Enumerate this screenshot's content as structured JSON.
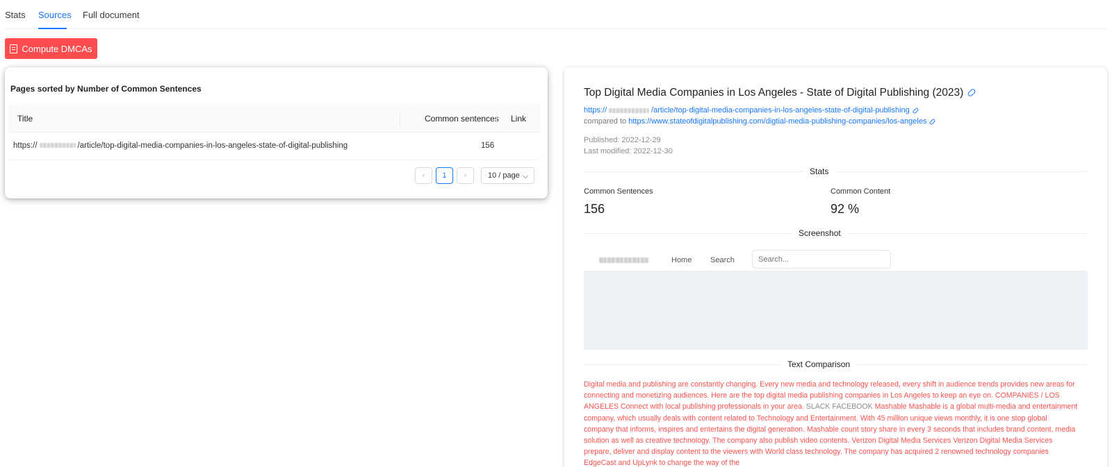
{
  "tabs": [
    {
      "label": "Stats",
      "active": false
    },
    {
      "label": "Sources",
      "active": true
    },
    {
      "label": "Full document",
      "active": false
    }
  ],
  "compute_button": {
    "label": "Compute DMCAs",
    "icon": "report-icon",
    "color": "#ff4d4f"
  },
  "sources_table": {
    "title": "Pages sorted by Number of Common Sentences",
    "columns": [
      "Title",
      "Common sentences",
      "Link"
    ],
    "rows": [
      {
        "title_prefix": "https://",
        "title_suffix": "/article/top-digital-media-companies-in-los-angeles-state-of-digital-publishing",
        "common_sentences": "156",
        "link": ""
      }
    ],
    "pagination": {
      "prev": "‹",
      "current": "1",
      "next": "›",
      "page_size": "10 / page"
    }
  },
  "detail": {
    "title": "Top Digital Media Companies in Los Angeles - State of Digital Publishing (2023)",
    "url_prefix": "https://",
    "url_suffix": "/article/top-digital-media-companies-in-los-angeles-state-of-digital-publishing",
    "compared_to_label": "compared to",
    "compared_url": "https://www.stateofdigitalpublishing.com/digtial-media-publishing-companies/los-angeles",
    "published": "Published: 2022-12-29",
    "last_modified": "Last modified: 2022-12-30",
    "stats_heading": "Stats",
    "common_sentences_label": "Common Sentences",
    "common_sentences_value": "156",
    "common_content_label": "Common Content",
    "common_content_value": "92 %",
    "screenshot_heading": "Screenshot",
    "screenshot": {
      "nav_links": [
        "Home",
        "Search"
      ],
      "search_placeholder": "Search..."
    },
    "text_comparison_heading": "Text Comparison",
    "text_comparison": {
      "part1": "Digital media and publishing are constantly changing. Every new media and technology released, every shift in audience trends provides new areas for connecting and monetizing audiences. Here are the top digital media publishing companies in Los Angeles to keep an eye on. COMPANIES / LOS ANGELES Connect with local publishing professionals in your area. ",
      "part_gray": "SLACK FACEBOOK",
      "part2": " Mashable Mashable is a global multi-media and entertainment company, which usually deals with content related to Technology and Entertainment. With 45 million unique views monthly, it is one stop global company that informs, inspires and entertains the digital generation. Mashable count story share in every 3 seconds that includes brand content, media solution as well as creative technology. The company also publish video contents. Verizon Digital Media Services Verizon Digital Media Services prepare, deliver and display content to the viewers with World class technology. The company has acquired 2 renowned technology companies EdgeCast and UpLynk to change the way of the"
    }
  },
  "colors": {
    "accent": "#1677ff",
    "danger": "#ff4d4f",
    "match_text": "#f5524f"
  }
}
